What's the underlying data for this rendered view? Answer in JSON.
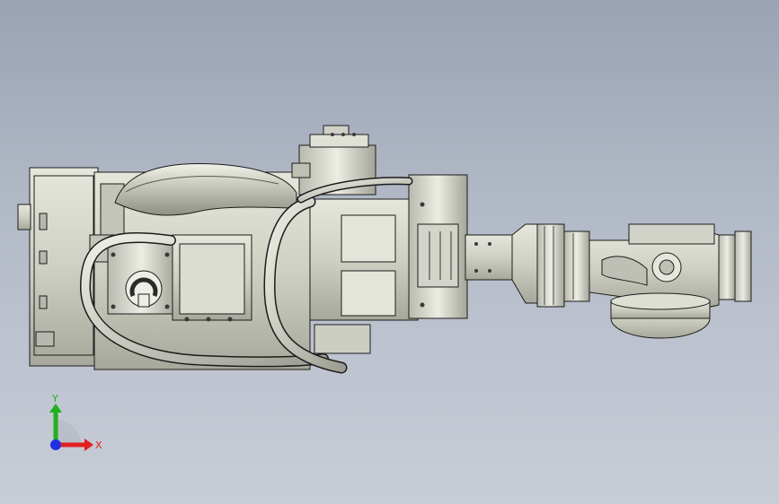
{
  "viewport": {
    "background_top": "#9aa3b4",
    "background_bottom": "#c8cdd7"
  },
  "model": {
    "icon": "robot-arm-assembly-model",
    "body_color": "#d6d7cc",
    "shade_color": "#a9aa9f",
    "edge_color": "#1c1c1c"
  },
  "triad": {
    "icon": "coordinate-triad-icon",
    "x_label": "X",
    "y_label": "Y",
    "x_color": "#e02020",
    "y_color": "#20b020",
    "z_color": "#2030e0"
  }
}
